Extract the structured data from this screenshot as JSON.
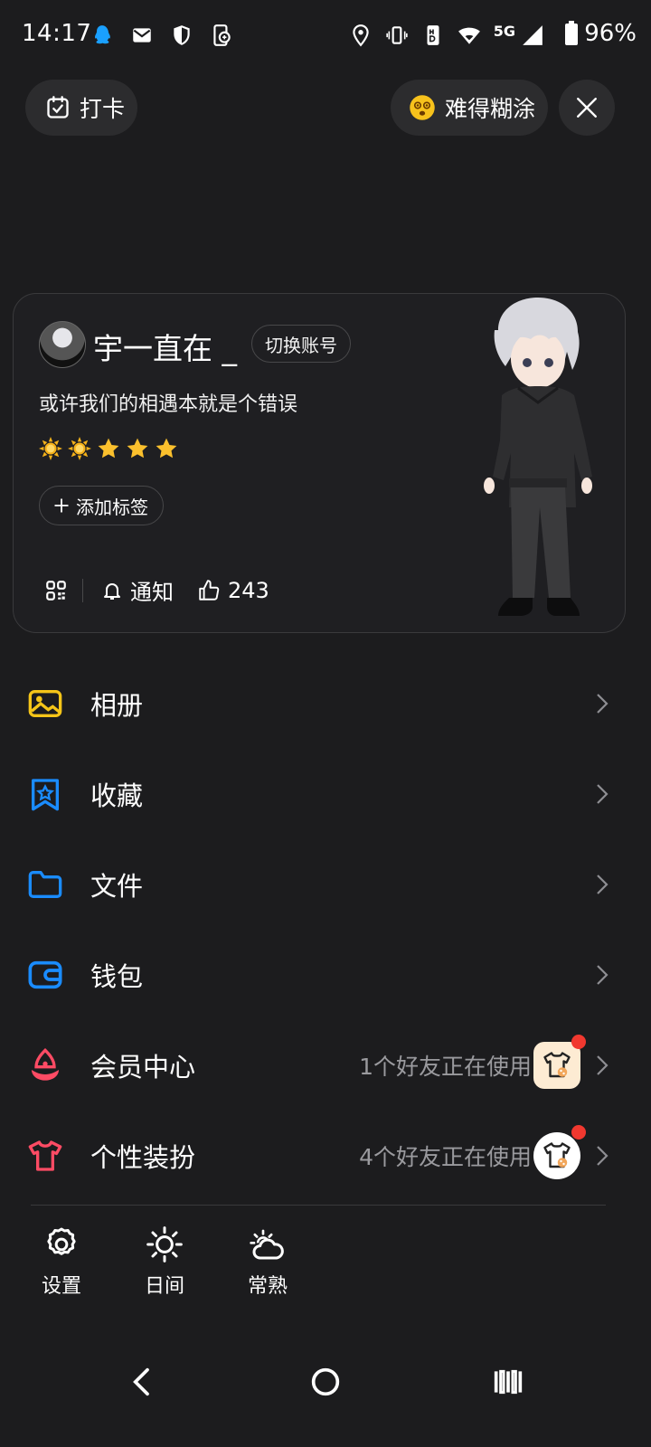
{
  "status_bar": {
    "time": "14:17",
    "network": "5G",
    "battery": "96%"
  },
  "top_bar": {
    "checkin_label": "打卡",
    "mood_label": "难得糊涂"
  },
  "profile": {
    "nickname": "宇一直在 _",
    "switch_account_label": "切换账号",
    "signature": "或许我们的相遇本就是个错误",
    "level_badges": [
      "sun",
      "sun",
      "star",
      "star",
      "star"
    ],
    "add_tag_label": "添加标签",
    "notify_label": "通知",
    "likes_count": "243"
  },
  "menu": [
    {
      "label": "相册",
      "icon": "image-icon",
      "color": "#f5c518"
    },
    {
      "label": "收藏",
      "icon": "bookmark-star-icon",
      "color": "#1a8cff"
    },
    {
      "label": "文件",
      "icon": "folder-icon",
      "color": "#1a8cff"
    },
    {
      "label": "钱包",
      "icon": "wallet-icon",
      "color": "#1a8cff"
    },
    {
      "label": "会员中心",
      "icon": "vip-icon",
      "color": "#ff4b64",
      "aux": "1个好友正在使用"
    },
    {
      "label": "个性装扮",
      "icon": "tshirt-icon",
      "color": "#ff4b64",
      "aux": "4个好友正在使用"
    }
  ],
  "bottom_tools": [
    {
      "label": "设置",
      "icon": "gear-icon"
    },
    {
      "label": "日间",
      "icon": "sun-icon"
    },
    {
      "label": "常熟",
      "icon": "weather-cloud-sun-icon"
    }
  ],
  "colors": {
    "background": "#1c1c1e",
    "card": "#1f1f22",
    "muted_text": "#9a9a9e",
    "badge_red": "#f1382f"
  }
}
